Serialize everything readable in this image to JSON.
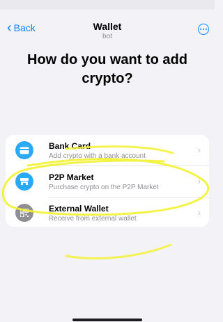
{
  "nav": {
    "back_label": "Back",
    "title": "Wallet",
    "subtitle": "bot"
  },
  "heading": "How do you want to add crypto?",
  "options": [
    {
      "title": "Bank Card",
      "subtitle": "Add crypto with a bank account",
      "icon": "card-icon",
      "color": "#2aa9f6"
    },
    {
      "title": "P2P Market",
      "subtitle": "Purchase crypto on the P2P Market",
      "icon": "market-icon",
      "color": "#2aa9f6"
    },
    {
      "title": "External Wallet",
      "subtitle": "Receive from external wallet",
      "icon": "qr-code-icon",
      "color": "#8e8e93"
    }
  ],
  "accent_color": "#0a84ff",
  "annotation_color": "#f2f232"
}
